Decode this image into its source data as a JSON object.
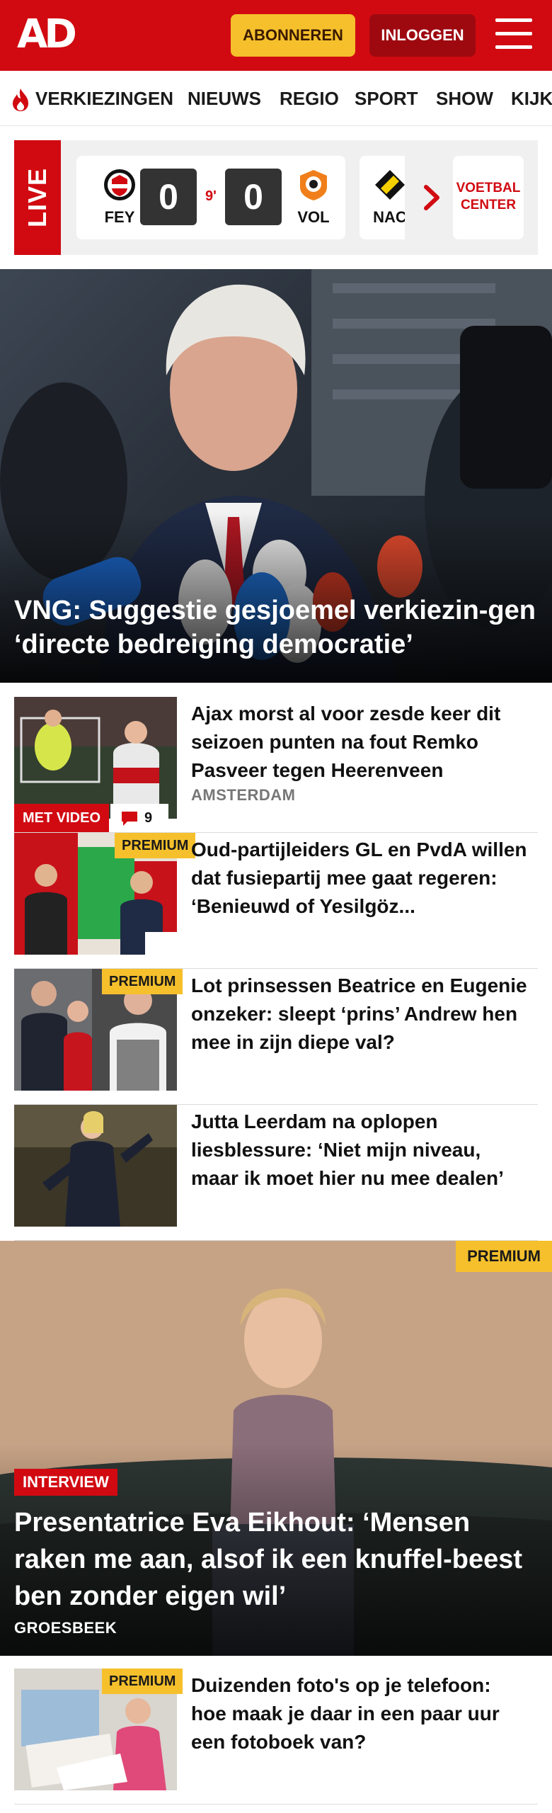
{
  "header": {
    "logo": "AD",
    "subscribe_label": "ABONNEREN",
    "login_label": "INLOGGEN",
    "brand_color": "#d10a11",
    "subscribe_color": "#f5c02c"
  },
  "nav": {
    "items": [
      {
        "label": "VERKIEZINGEN",
        "icon": "flame-icon"
      },
      {
        "label": "NIEUWS"
      },
      {
        "label": "REGIO"
      },
      {
        "label": "SPORT"
      },
      {
        "label": "SHOW"
      },
      {
        "label": "KIJK"
      }
    ]
  },
  "live": {
    "label": "LIVE",
    "match": {
      "home_code": "FEY",
      "home_score": "0",
      "minute": "9'",
      "away_score": "0",
      "away_code": "VOL"
    },
    "next_match_code": "NAC",
    "voetbal_center_label": "VOETBAL CENTER"
  },
  "hero": {
    "title": "VNG: Suggestie gesjoemel verkiezin-gen ‘directe bedreiging democratie’"
  },
  "articles": [
    {
      "title": "Ajax morst al voor zesde keer dit seizoen punten na fout Remko Pasveer tegen Heerenveen",
      "location": "AMSTERDAM",
      "video_label": "MET VIDEO",
      "comments": "9"
    },
    {
      "title": "Oud-partijleiders GL en PvdA willen dat fusiepartij mee gaat regeren: ‘Benieuwd of Yesilgöz...",
      "premium_label": "PREMIUM"
    },
    {
      "title": "Lot prinsessen Beatrice en Eugenie onzeker: sleept ‘prins’ Andrew hen mee in zijn diepe val?",
      "premium_label": "PREMIUM"
    },
    {
      "title": "Jutta Leerdam na oplopen liesblessure: ‘Niet mijn niveau, maar ik moet hier nu mee dealen’"
    }
  ],
  "feature": {
    "premium_label": "PREMIUM",
    "tag": "INTERVIEW",
    "title": "Presentatrice Eva Eikhout: ‘Mensen raken me aan, alsof ik een knuffel-beest ben zonder eigen wil’",
    "location": "GROESBEEK"
  },
  "bottom_articles": [
    {
      "title": "Duizenden foto's op je telefoon: hoe maak je daar in een paar uur een fotoboek van?",
      "premium_label": "PREMIUM"
    }
  ]
}
